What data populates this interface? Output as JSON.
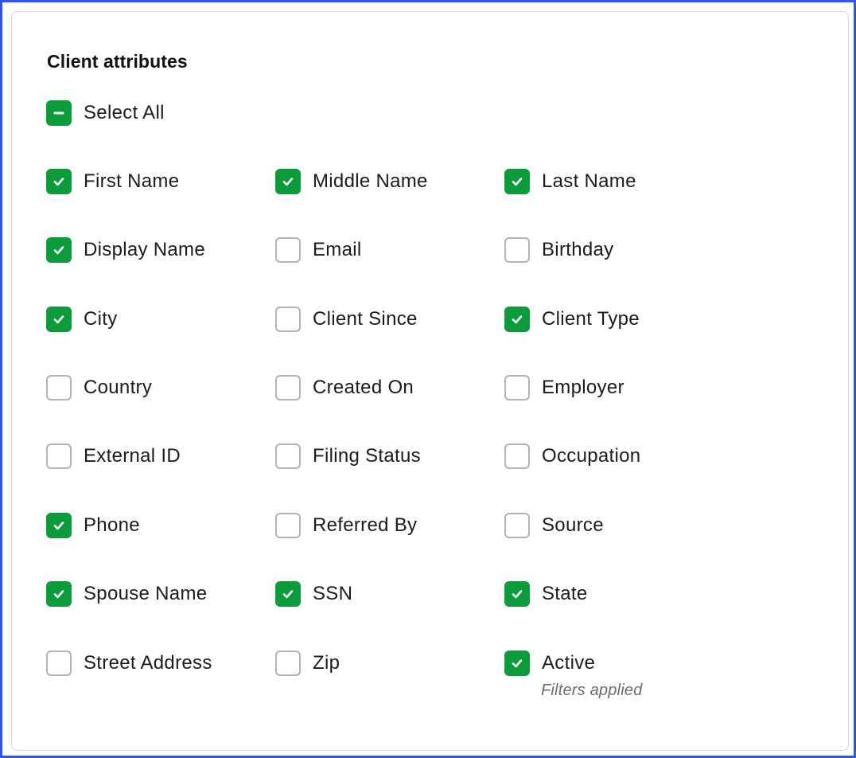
{
  "panel": {
    "title": "Client attributes",
    "select_all": {
      "label": "Select All",
      "state": "indeterminate"
    },
    "columns": [
      {
        "items": [
          {
            "label": "First Name",
            "checked": true
          },
          {
            "label": "Display Name",
            "checked": true
          },
          {
            "label": "City",
            "checked": true
          },
          {
            "label": "Country",
            "checked": false
          },
          {
            "label": "External ID",
            "checked": false
          },
          {
            "label": "Phone",
            "checked": true
          },
          {
            "label": "Spouse Name",
            "checked": true
          },
          {
            "label": "Street Address",
            "checked": false
          }
        ]
      },
      {
        "items": [
          {
            "label": "Middle Name",
            "checked": true
          },
          {
            "label": "Email",
            "checked": false
          },
          {
            "label": "Client Since",
            "checked": false
          },
          {
            "label": "Created On",
            "checked": false
          },
          {
            "label": "Filing Status",
            "checked": false
          },
          {
            "label": "Referred By",
            "checked": false
          },
          {
            "label": "SSN",
            "checked": true
          },
          {
            "label": "Zip",
            "checked": false
          }
        ]
      },
      {
        "items": [
          {
            "label": "Last Name",
            "checked": true
          },
          {
            "label": "Birthday",
            "checked": false
          },
          {
            "label": "Client Type",
            "checked": true
          },
          {
            "label": "Employer",
            "checked": false
          },
          {
            "label": "Occupation",
            "checked": false
          },
          {
            "label": "Source",
            "checked": false
          },
          {
            "label": "State",
            "checked": true
          },
          {
            "label": "Active",
            "checked": true
          }
        ]
      }
    ],
    "active_note": "Filters applied"
  },
  "colors": {
    "accent": "#0c9b3a",
    "frame_border": "#2f52f5",
    "unchecked_border": "#b3b3b3"
  },
  "icons": {
    "checked": "check-icon",
    "indeterminate": "minus-icon"
  }
}
